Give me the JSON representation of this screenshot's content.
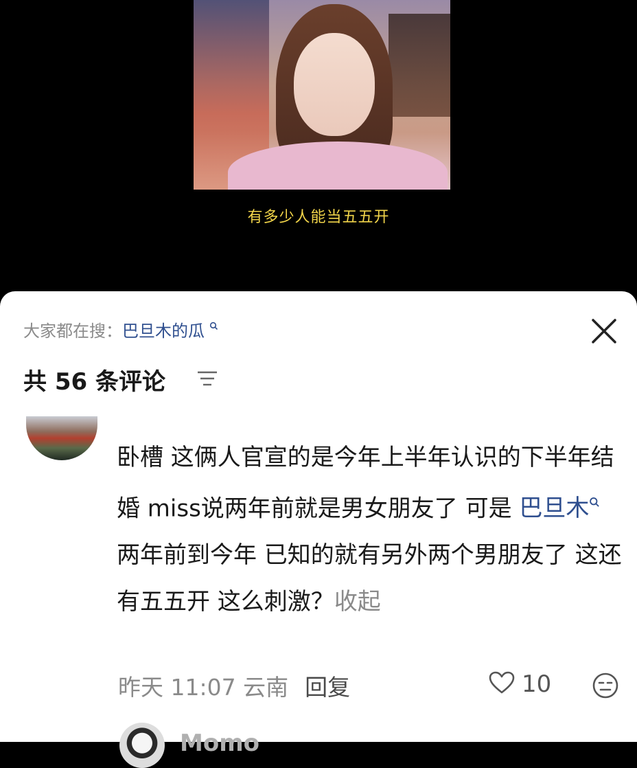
{
  "video": {
    "subtitle": "有多少人能当五五开"
  },
  "sheet": {
    "search_prefix": "大家都在搜：",
    "search_term": "巴旦木的瓜",
    "comment_count_label": "共 56 条评论"
  },
  "comment": {
    "text_part1": "卧槽 这俩人官宣的是今年上半年认识的下半年结婚 miss说两年前就是男女朋友了 可是 ",
    "keyword": "巴旦木",
    "text_part2": " 两年前到今年 已知的就有另外两个男朋友了 这还有五五开 这么刺激？",
    "collapse_label": "收起",
    "time_location": "昨天 11:07 云南",
    "reply_label": "回复",
    "like_count": "10"
  },
  "next_comment": {
    "name": "Momo"
  },
  "colors": {
    "subtitle": "#f2d54a",
    "link": "#2f4f8f",
    "muted": "#8a8a8a"
  },
  "icons": [
    "search-icon",
    "close-icon",
    "sort-icon",
    "heart-icon",
    "dislike-face-icon"
  ]
}
